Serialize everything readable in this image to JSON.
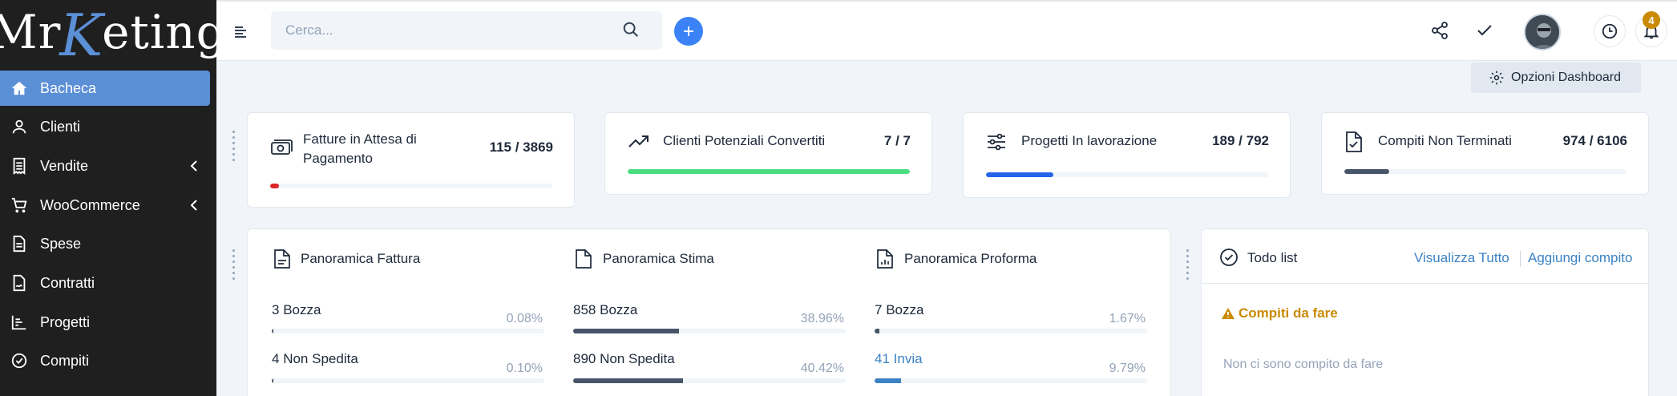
{
  "app": {
    "logo_left": "Mr",
    "logo_k": "K",
    "logo_right": "eting"
  },
  "sidebar": {
    "items": [
      {
        "label": "Bacheca",
        "icon": "home-icon",
        "active": true
      },
      {
        "label": "Clienti",
        "icon": "user-icon"
      },
      {
        "label": "Vendite",
        "icon": "receipt-icon",
        "has_sub": true
      },
      {
        "label": "WooCommerce",
        "icon": "cart-icon",
        "has_sub": true
      },
      {
        "label": "Spese",
        "icon": "document-icon"
      },
      {
        "label": "Contratti",
        "icon": "contract-icon"
      },
      {
        "label": "Progetti",
        "icon": "chart-icon"
      },
      {
        "label": "Compiti",
        "icon": "check-circle-icon"
      }
    ]
  },
  "topbar": {
    "search_placeholder": "Cerca...",
    "notifications_count": "4"
  },
  "dashboard_options_label": "Opzioni Dashboard",
  "stats": [
    {
      "title": "Fatture in Attesa di Pagamento",
      "value": "115 / 3869",
      "progress": 0.03,
      "color": "#dc2626",
      "icon": "money-icon"
    },
    {
      "title": "Clienti Potenziali Convertiti",
      "value": "7 / 7",
      "progress": 1.0,
      "color": "#4ade80",
      "icon": "trending-up-icon"
    },
    {
      "title": "Progetti In lavorazione",
      "value": "189 / 792",
      "progress": 0.24,
      "color": "#2563eb",
      "icon": "sliders-icon"
    },
    {
      "title": "Compiti Non Terminati",
      "value": "974 / 6106",
      "progress": 0.16,
      "color": "#475569",
      "icon": "file-check-icon"
    }
  ],
  "overview": {
    "columns": [
      {
        "title": "Panoramica Fattura",
        "rows": [
          {
            "count": "3",
            "label": "Bozza",
            "pct": "0.08%",
            "progress": 0.0008
          },
          {
            "count": "4",
            "label": "Non Spedita",
            "pct": "0.10%",
            "progress": 0.001
          }
        ]
      },
      {
        "title": "Panoramica Stima",
        "rows": [
          {
            "count": "858",
            "label": "Bozza",
            "pct": "38.96%",
            "progress": 0.3896
          },
          {
            "count": "890",
            "label": "Non Spedita",
            "pct": "40.42%",
            "progress": 0.4042
          }
        ]
      },
      {
        "title": "Panoramica Proforma",
        "rows": [
          {
            "count": "7",
            "label": "Bozza",
            "pct": "1.67%",
            "progress": 0.0167
          },
          {
            "count": "41",
            "label": "Invia",
            "pct": "9.79%",
            "progress": 0.0979,
            "link": true
          }
        ]
      }
    ]
  },
  "todo": {
    "title": "Todo list",
    "view_all": "Visualizza Tutto",
    "add": "Aggiungi compito",
    "section": "Compiti da fare",
    "empty": "Non ci sono compito da fare"
  }
}
